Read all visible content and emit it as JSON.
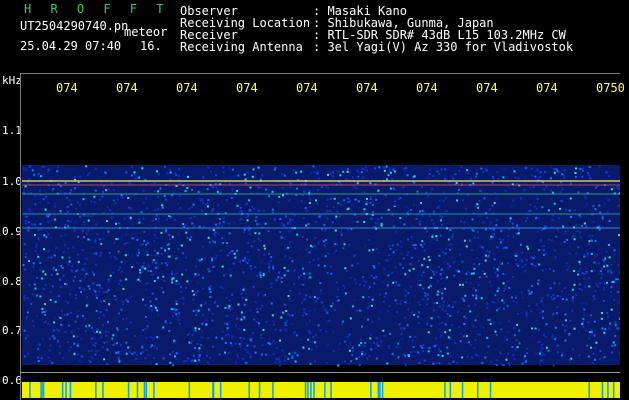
{
  "header": {
    "program": "H R O F F T",
    "filename": "UT2504290740.pn",
    "meteor_word": "meteor",
    "datetime": "25.04.29 07:40",
    "number": "16.",
    "fields": [
      {
        "label": "Observer",
        "value": ": Masaki Kano"
      },
      {
        "label": "Receiving Location",
        "value": ": Shibukawa, Gunma, Japan"
      },
      {
        "label": "Receiver",
        "value": ": RTL-SDR SDR# 43dB L15 103.2MHz CW"
      },
      {
        "label": "Receiving Antenna",
        "value": ": 3el Yagi(V) Az 330 for Vladivostok"
      }
    ]
  },
  "time_axis": {
    "labels": [
      "074",
      "074",
      "074",
      "074",
      "074",
      "074",
      "074",
      "074",
      "074",
      "0750"
    ]
  },
  "freq_axis": {
    "unit": "kHz",
    "labels": [
      "1.1",
      "1.0",
      "0.9",
      "0.8",
      "0.7",
      "0.6"
    ]
  },
  "colors": {
    "background": "#000000",
    "header_text": "#ffffff",
    "program_text": "#2fd05a",
    "time_text": "#ffff55",
    "noise_band": "#1030c0",
    "signal_line": "#e8e850",
    "strip": "#f0f000"
  }
}
